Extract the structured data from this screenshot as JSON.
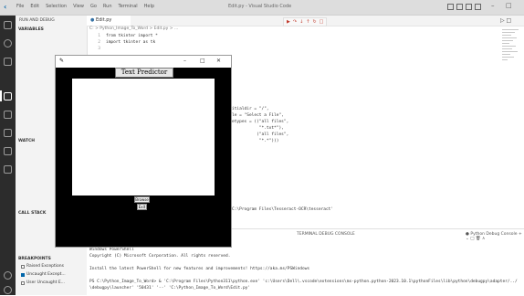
{
  "titlebar": {
    "menus": [
      "File",
      "Edit",
      "Selection",
      "View",
      "Go",
      "Run",
      "Terminal",
      "Help"
    ],
    "title": "Edit.py - Visual Studio Code"
  },
  "sidebar": {
    "header": "RUN AND DEBUG",
    "variables": "VARIABLES",
    "watch": "WATCH",
    "call_stack": "CALL STACK",
    "breakpoints": "BREAKPOINTS",
    "bp_items": [
      {
        "label": "Raised Exceptions",
        "checked": false
      },
      {
        "label": "Uncaught Except...",
        "checked": true
      },
      {
        "label": "User Uncaught E...",
        "checked": false
      }
    ]
  },
  "editor": {
    "tab": "Edit.py",
    "breadcrumb": "C: > Python_Image_To_Word > Edit.py > ...",
    "code": [
      {
        "n": "1",
        "text": "from tkinter import *"
      },
      {
        "n": "2",
        "text": "import tkinter as tk"
      },
      {
        "n": "3",
        "text": ""
      }
    ],
    "code_right": [
      "itialdir = \"/\",",
      "le = \"Select a File\",",
      "etypes = ((\"all files\",",
      "           \"*.txt*\"),",
      "          (\"all files\",",
      "           \"*.*\")))",
      "C:\\Program Files\\Tesseract-OCR\\tesseract'"
    ]
  },
  "panel": {
    "tabs": "TERMINAL  DEBUG CONSOLE",
    "right": "Python Debug Console",
    "terminal_lines": [
      "Windows PowerShell",
      "Copyright (C) Microsoft Corporation. All rights reserved.",
      "",
      "Install the latest PowerShell for new features and improvements! https://aka.ms/PSWindows",
      "",
      "PS C:\\Python_Image_To_Word>  & 'C:\\Program Files\\Python311\\python.exe' 'c:\\Users\\Dell\\.vscode\\extensions\\ms-python.python-2023.10.1\\pythonFiles\\lib\\python\\debugpy\\adapter/../",
      "\\debugpy\\launcher' '50431' '--' 'C:\\Python_Image_To_Word\\Edit.py'"
    ]
  },
  "tk": {
    "feather": "🪶",
    "title": "Text Predictor",
    "browse": "Browse",
    "exit": "Exit"
  }
}
